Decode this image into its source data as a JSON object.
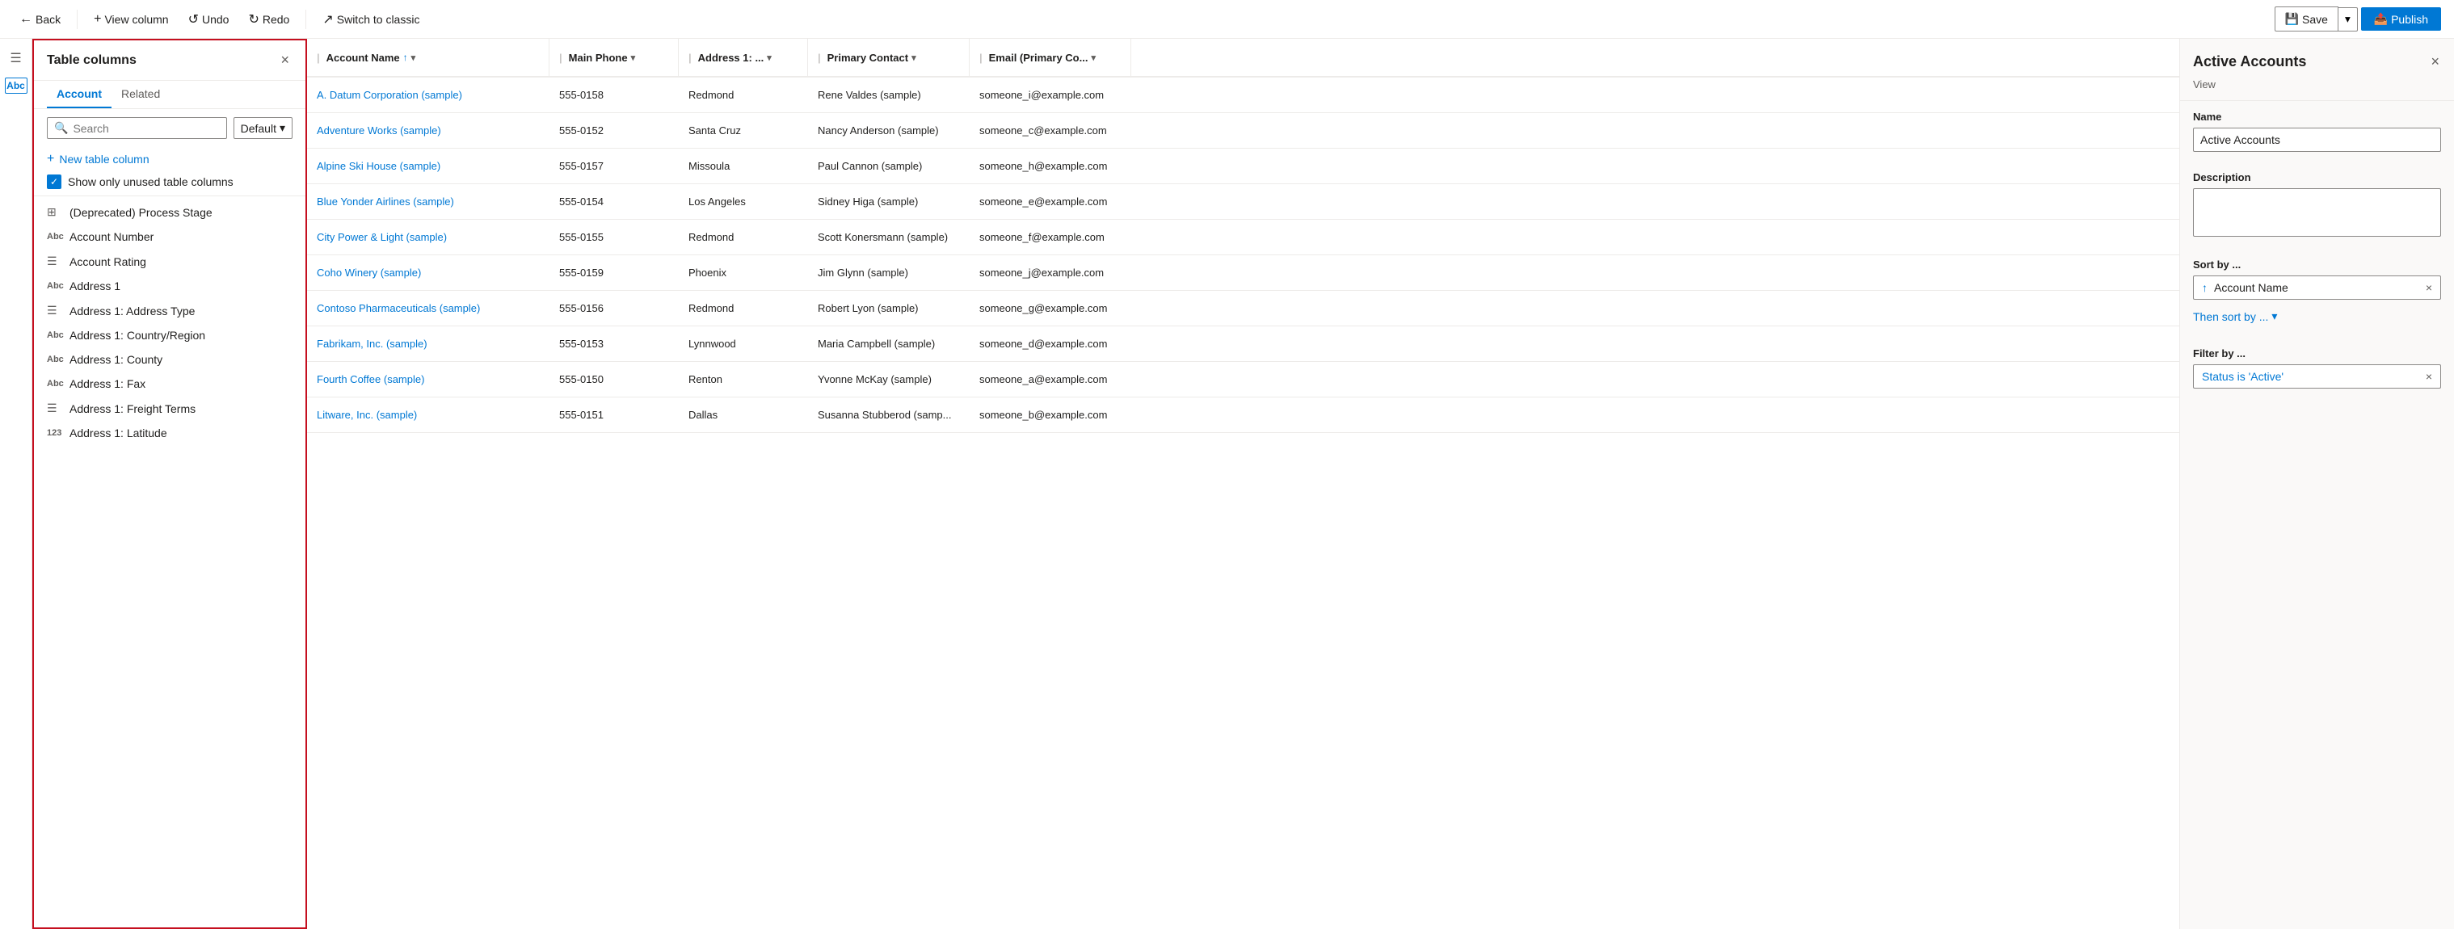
{
  "toolbar": {
    "back_label": "Back",
    "view_column_label": "View column",
    "undo_label": "Undo",
    "redo_label": "Redo",
    "switch_classic_label": "Switch to classic",
    "save_label": "Save",
    "publish_label": "Publish"
  },
  "columns_panel": {
    "title": "Table columns",
    "close_icon": "×",
    "tab_account": "Account",
    "tab_related": "Related",
    "search_placeholder": "Search",
    "default_label": "Default",
    "new_column_label": "New table column",
    "show_unused_label": "Show only unused table columns",
    "items": [
      {
        "name": "(Deprecated) Process Stage",
        "icon": "grid"
      },
      {
        "name": "Account Number",
        "icon": "abc"
      },
      {
        "name": "Account Rating",
        "icon": "menu"
      },
      {
        "name": "Address 1",
        "icon": "abc"
      },
      {
        "name": "Address 1: Address Type",
        "icon": "menu"
      },
      {
        "name": "Address 1: Country/Region",
        "icon": "abc"
      },
      {
        "name": "Address 1: County",
        "icon": "abc"
      },
      {
        "name": "Address 1: Fax",
        "icon": "abc"
      },
      {
        "name": "Address 1: Freight Terms",
        "icon": "menu"
      },
      {
        "name": "Address 1: Latitude",
        "icon": "num"
      }
    ]
  },
  "grid": {
    "columns": [
      {
        "label": "Account Name",
        "sort": "↑",
        "has_chevron": true
      },
      {
        "label": "Main Phone",
        "has_chevron": true
      },
      {
        "label": "Address 1: ...",
        "has_chevron": true
      },
      {
        "label": "Primary Contact",
        "has_chevron": true
      },
      {
        "label": "Email (Primary Co...",
        "has_chevron": true
      }
    ],
    "rows": [
      {
        "account": "A. Datum Corporation (sample)",
        "phone": "555-0158",
        "address": "Redmond",
        "contact": "Rene Valdes (sample)",
        "email": "someone_i@example.com"
      },
      {
        "account": "Adventure Works (sample)",
        "phone": "555-0152",
        "address": "Santa Cruz",
        "contact": "Nancy Anderson (sample)",
        "email": "someone_c@example.com"
      },
      {
        "account": "Alpine Ski House (sample)",
        "phone": "555-0157",
        "address": "Missoula",
        "contact": "Paul Cannon (sample)",
        "email": "someone_h@example.com"
      },
      {
        "account": "Blue Yonder Airlines (sample)",
        "phone": "555-0154",
        "address": "Los Angeles",
        "contact": "Sidney Higa (sample)",
        "email": "someone_e@example.com"
      },
      {
        "account": "City Power & Light (sample)",
        "phone": "555-0155",
        "address": "Redmond",
        "contact": "Scott Konersmann (sample)",
        "email": "someone_f@example.com"
      },
      {
        "account": "Coho Winery (sample)",
        "phone": "555-0159",
        "address": "Phoenix",
        "contact": "Jim Glynn (sample)",
        "email": "someone_j@example.com"
      },
      {
        "account": "Contoso Pharmaceuticals (sample)",
        "phone": "555-0156",
        "address": "Redmond",
        "contact": "Robert Lyon (sample)",
        "email": "someone_g@example.com"
      },
      {
        "account": "Fabrikam, Inc. (sample)",
        "phone": "555-0153",
        "address": "Lynnwood",
        "contact": "Maria Campbell (sample)",
        "email": "someone_d@example.com"
      },
      {
        "account": "Fourth Coffee (sample)",
        "phone": "555-0150",
        "address": "Renton",
        "contact": "Yvonne McKay (sample)",
        "email": "someone_a@example.com"
      },
      {
        "account": "Litware, Inc. (sample)",
        "phone": "555-0151",
        "address": "Dallas",
        "contact": "Susanna Stubberod (samp...",
        "email": "someone_b@example.com"
      }
    ]
  },
  "right_panel": {
    "title": "Active Accounts",
    "subtitle": "View",
    "close_icon": "×",
    "name_label": "Name",
    "name_value": "Active Accounts",
    "description_label": "Description",
    "description_placeholder": "",
    "sort_label": "Sort by ...",
    "sort_value": "Account Name",
    "sort_icon": "↑",
    "sort_remove": "×",
    "then_sort_label": "Then sort by ...",
    "filter_label": "Filter by ...",
    "filter_value": "Status is 'Active'",
    "filter_remove": "×"
  }
}
